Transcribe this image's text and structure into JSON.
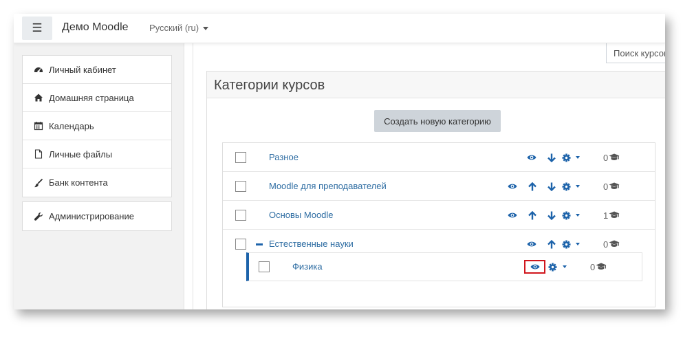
{
  "header": {
    "menu_icon": "hamburger-icon",
    "brand": "Демо Moodle",
    "language": "Русский (ru)"
  },
  "sidebar": {
    "items": [
      {
        "label": "Личный кабинет",
        "icon": "dashboard-icon"
      },
      {
        "label": "Домашняя страница",
        "icon": "home-icon"
      },
      {
        "label": "Календарь",
        "icon": "calendar-icon"
      },
      {
        "label": "Личные файлы",
        "icon": "file-icon"
      },
      {
        "label": "Банк контента",
        "icon": "paint-brush-icon"
      }
    ],
    "admin": {
      "label": "Администрирование",
      "icon": "wrench-icon"
    }
  },
  "search": {
    "placeholder": "Поиск курсов"
  },
  "categories": {
    "title": "Категории курсов",
    "create_button": "Создать новую категорию",
    "rows": [
      {
        "name": "Разное",
        "count": "0"
      },
      {
        "name": "Moodle для преподавателей",
        "count": "0"
      },
      {
        "name": "Основы Moodle",
        "count": "1"
      },
      {
        "name": "Естественные науки",
        "count": "0",
        "expanded": true
      },
      {
        "name": "Физика",
        "count": "0",
        "child": true,
        "visibility_highlighted": true
      }
    ]
  },
  "colors": {
    "link": "#2d6ca2",
    "accent": "#1d63aa",
    "highlight": "#d0161d"
  }
}
